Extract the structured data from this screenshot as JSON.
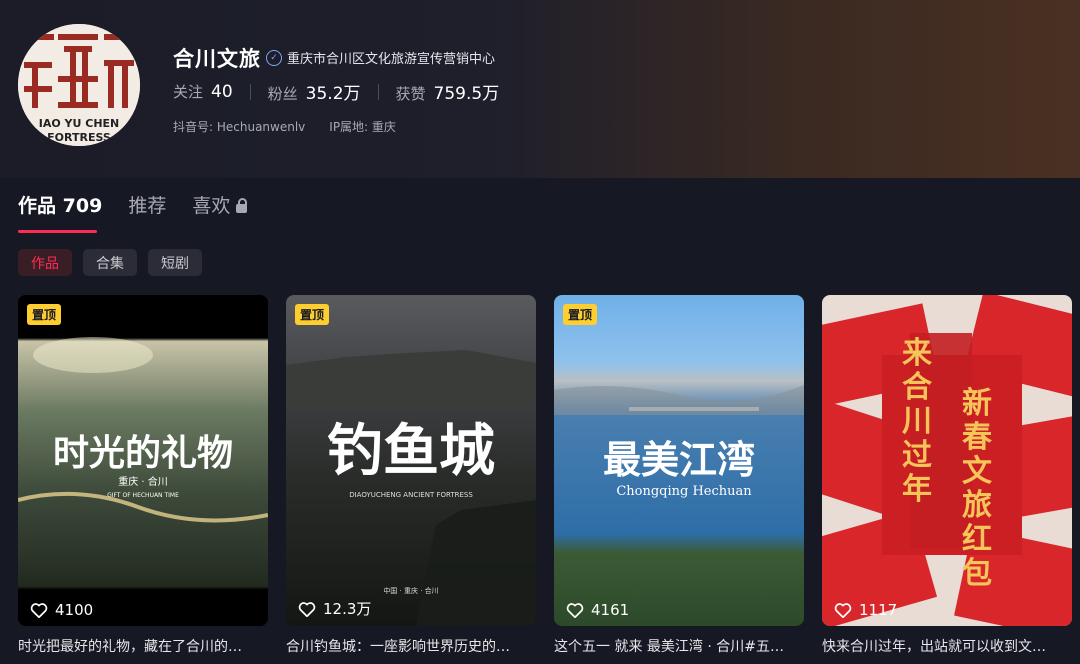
{
  "profile": {
    "name": "合川文旅",
    "verification": "重庆市合川区文化旅游宣传营销中心",
    "avatar_text": "IAO YU CHEN FORTRESS",
    "stats": [
      {
        "label": "关注",
        "value": "40"
      },
      {
        "label": "粉丝",
        "value": "35.2万"
      },
      {
        "label": "获赞",
        "value": "759.5万"
      }
    ],
    "douyin_id": "抖音号: Hechuanwenlv",
    "ip_location": "IP属地: 重庆"
  },
  "tabs": [
    {
      "label": "作品",
      "count": "709"
    },
    {
      "label": "推荐"
    },
    {
      "label": "喜欢"
    }
  ],
  "filters": [
    "作品",
    "合集",
    "短剧"
  ],
  "videos": [
    {
      "pinned": "置顶",
      "cover_title": "时光的礼物",
      "cover_sub": "重庆 · 合川",
      "cover_en": "GIFT OF HECHUAN TIME",
      "likes": "4100",
      "caption": "时光把最好的礼物，藏在了合川的…"
    },
    {
      "pinned": "置顶",
      "cover_title": "钓鱼城",
      "cover_sub": "DIAOYUCHENG ANCIENT FORTRESS",
      "cover_en": "中国 · 重庆 · 合川",
      "likes": "12.3万",
      "caption": "合川钓鱼城：一座影响世界历史的…"
    },
    {
      "pinned": "置顶",
      "cover_title": "最美江湾",
      "cover_sub": "Chongqing Hechuan",
      "likes": "4161",
      "caption": "这个五一 就来 最美江湾 · 合川#五…"
    },
    {
      "cover_title": "来合川过年",
      "cover_sub": "新春文旅红包",
      "likes": "1117",
      "caption": "快来合川过年，出站就可以收到文…"
    }
  ],
  "colors": {
    "accent": "#fe2c55",
    "pin": "#fecd2e",
    "background": "#161823"
  }
}
